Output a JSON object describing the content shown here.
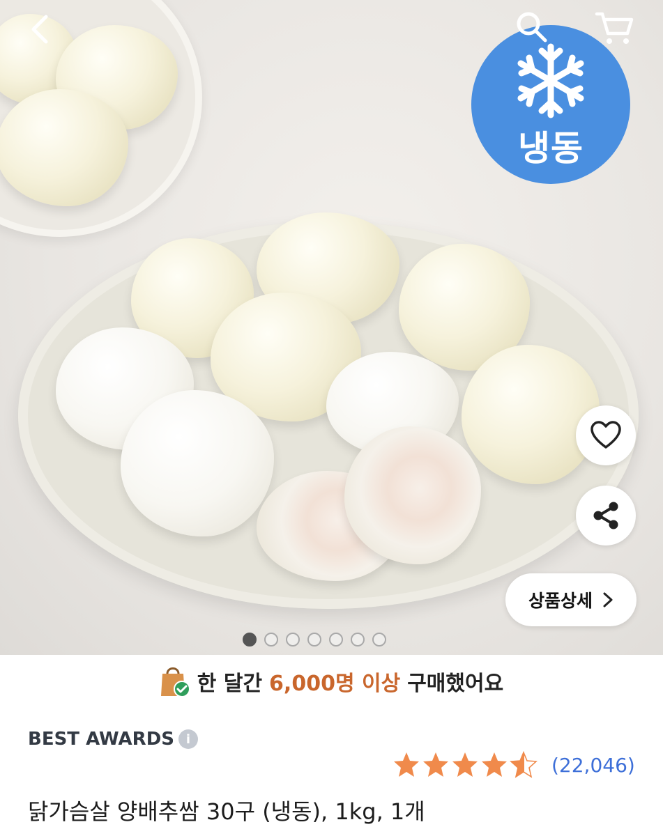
{
  "badge": {
    "label": "냉동",
    "icon": "snowflake-icon",
    "color": "#4a8fe0"
  },
  "header": {
    "back_icon": "back-arrow-icon",
    "search_icon": "search-icon",
    "cart_icon": "cart-icon"
  },
  "actions": {
    "like_icon": "heart-icon",
    "share_icon": "share-icon",
    "detail_label": "상품상세",
    "detail_icon": "chevron-right-icon"
  },
  "carousel": {
    "total": 7,
    "active_index": 0
  },
  "purchase": {
    "prefix": "한 달간",
    "highlight": "6,000명 이상",
    "suffix": "구매했어요",
    "highlight_color": "#c9662c"
  },
  "award": {
    "label": "BEST AWARDS"
  },
  "rating": {
    "stars": 4.5,
    "max": 5,
    "count": "(22,046)",
    "star_color": "#f08a4b"
  },
  "product": {
    "title": "닭가슴살 양배추쌈 30구 (냉동), 1kg, 1개"
  }
}
